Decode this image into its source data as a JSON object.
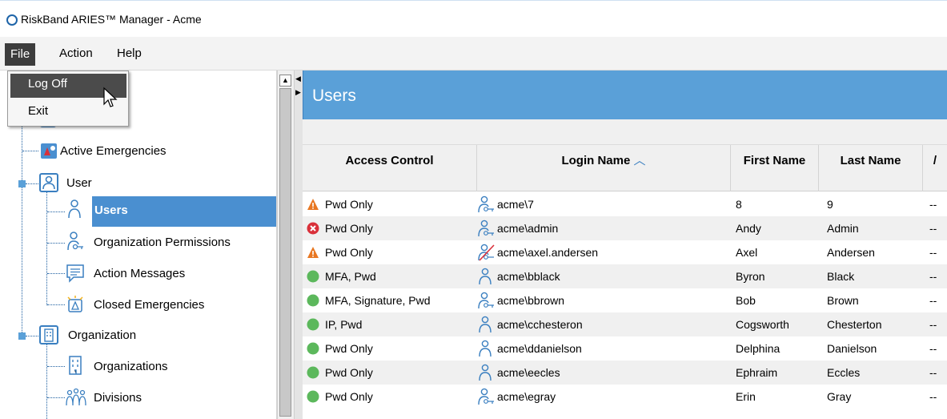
{
  "window": {
    "title": "RiskBand ARIES™ Manager - Acme"
  },
  "menu": {
    "file": "File",
    "action": "Action",
    "help": "Help"
  },
  "file_menu": {
    "items": [
      "Log Off",
      "Exit"
    ]
  },
  "tree": {
    "active_emergencies": "Active Emergencies",
    "user": "User",
    "users": "Users",
    "org_permissions": "Organization Permissions",
    "action_messages": "Action Messages",
    "closed_emergencies": "Closed Emergencies",
    "organization": "Organization",
    "organizations": "Organizations",
    "divisions": "Divisions"
  },
  "panel": {
    "title": "Users"
  },
  "columns": {
    "access": "Access Control",
    "login": "Login Name",
    "first": "First Name",
    "last": "Last Name",
    "sort_indicator": "^"
  },
  "rows": [
    {
      "status": "warning",
      "access": "Pwd Only",
      "login": "acme\\7",
      "first": "8",
      "last": "9",
      "extra": "--",
      "icon": "user-key-icon"
    },
    {
      "status": "error",
      "access": "Pwd Only",
      "login": "acme\\admin",
      "first": "Andy",
      "last": "Admin",
      "extra": "--",
      "icon": "user-key-icon"
    },
    {
      "status": "warning",
      "access": "Pwd Only",
      "login": "acme\\axel.andersen",
      "first": "Axel",
      "last": "Andersen",
      "extra": "--",
      "icon": "user-disabled-icon"
    },
    {
      "status": "ok",
      "access": "MFA, Pwd",
      "login": "acme\\bblack",
      "first": "Byron",
      "last": "Black",
      "extra": "--",
      "icon": "user-icon"
    },
    {
      "status": "ok",
      "access": "MFA, Signature, Pwd",
      "login": "acme\\bbrown",
      "first": "Bob",
      "last": "Brown",
      "extra": "--",
      "icon": "user-key-icon"
    },
    {
      "status": "ok",
      "access": "IP, Pwd",
      "login": "acme\\cchesteron",
      "first": "Cogsworth",
      "last": "Chesterton",
      "extra": "--",
      "icon": "user-icon"
    },
    {
      "status": "ok",
      "access": "Pwd Only",
      "login": "acme\\ddanielson",
      "first": "Delphina",
      "last": "Danielson",
      "extra": "--",
      "icon": "user-icon"
    },
    {
      "status": "ok",
      "access": "Pwd Only",
      "login": "acme\\eecles",
      "first": "Ephraim",
      "last": "Eccles",
      "extra": "--",
      "icon": "user-icon"
    },
    {
      "status": "ok",
      "access": "Pwd Only",
      "login": "acme\\egray",
      "first": "Erin",
      "last": "Gray",
      "extra": "--",
      "icon": "user-key-icon"
    }
  ],
  "colors": {
    "header_blue": "#5aa0d8",
    "selection": "#4a8fd0",
    "ok": "#5cb85c",
    "warning": "#e87722",
    "error": "#d9303a"
  }
}
